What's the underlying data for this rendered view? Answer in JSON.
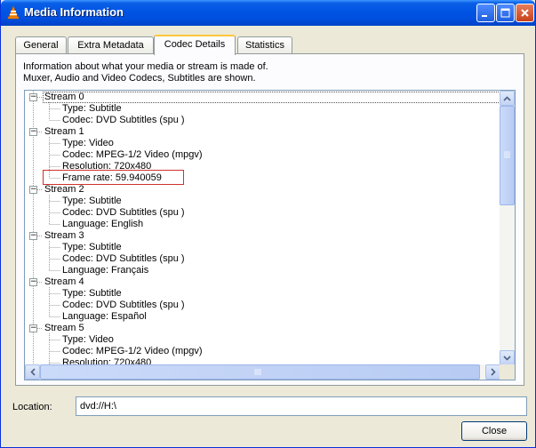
{
  "window": {
    "title": "Media Information"
  },
  "tabs": [
    {
      "label": "General"
    },
    {
      "label": "Extra Metadata"
    },
    {
      "label": "Codec Details"
    },
    {
      "label": "Statistics"
    }
  ],
  "active_tab": "Codec Details",
  "info_text": [
    "Information about what your media or stream is made of.",
    "Muxer, Audio and Video Codecs, Subtitles are shown."
  ],
  "tree": [
    {
      "label": "Stream 0",
      "children": [
        "Type: Subtitle",
        "Codec: DVD Subtitles (spu )"
      ]
    },
    {
      "label": "Stream 1",
      "children": [
        "Type: Video",
        "Codec: MPEG-1/2 Video (mpgv)",
        "Resolution: 720x480",
        "Frame rate: 59.940059"
      ]
    },
    {
      "label": "Stream 2",
      "children": [
        "Type: Subtitle",
        "Codec: DVD Subtitles (spu )",
        "Language: English"
      ]
    },
    {
      "label": "Stream 3",
      "children": [
        "Type: Subtitle",
        "Codec: DVD Subtitles (spu )",
        "Language: Français"
      ]
    },
    {
      "label": "Stream 4",
      "children": [
        "Type: Subtitle",
        "Codec: DVD Subtitles (spu )",
        "Language: Español"
      ]
    },
    {
      "label": "Stream 5",
      "children": [
        "Type: Video",
        "Codec: MPEG-1/2 Video (mpgv)",
        "Resolution: 720x480"
      ]
    }
  ],
  "highlighted_item": "Frame rate: 59.940059",
  "location": {
    "label": "Location:",
    "value": "dvd://H:\\"
  },
  "buttons": {
    "close": "Close"
  },
  "colors": {
    "titlebar": "#0054e3",
    "highlight_border": "#d0322f",
    "tab_accent": "#ffc73c"
  }
}
